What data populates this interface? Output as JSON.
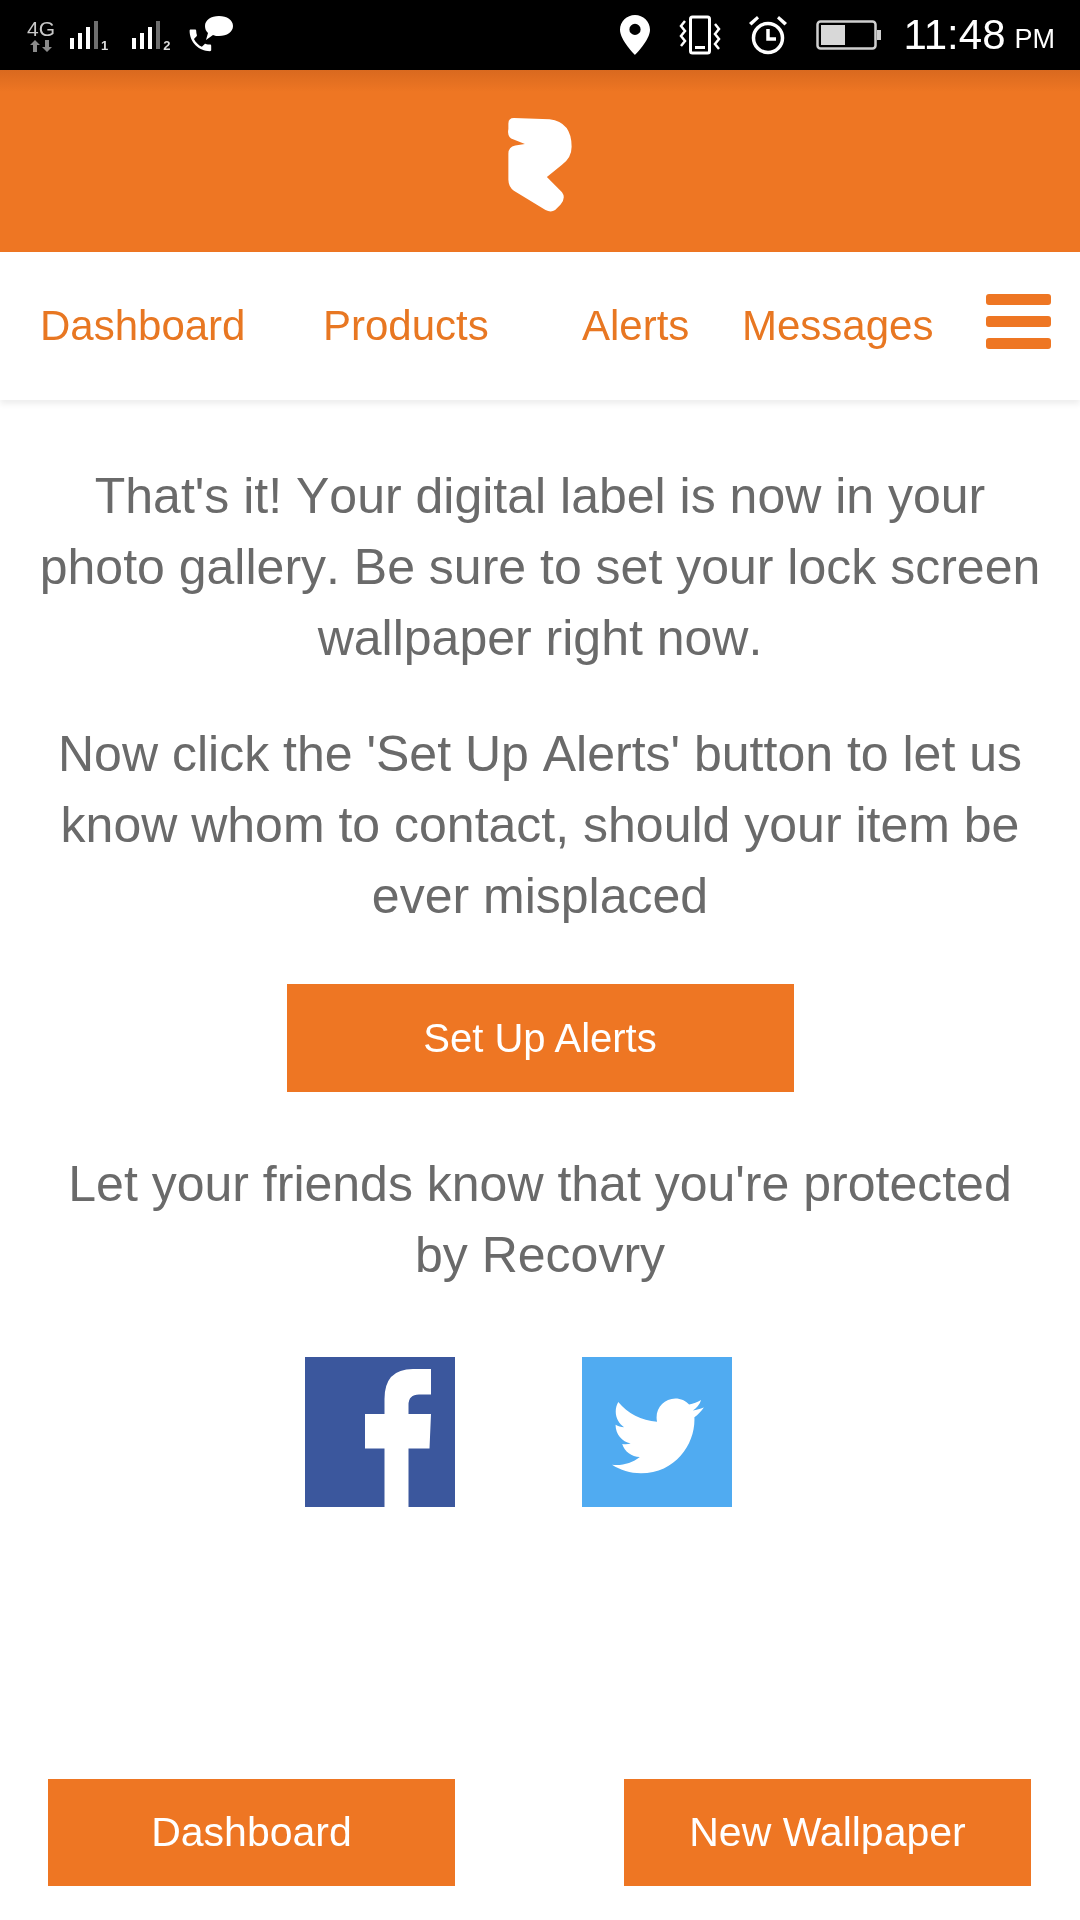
{
  "status_bar": {
    "network": "4G",
    "sim_labels": [
      "1",
      "2"
    ],
    "time": "11:48",
    "meridiem": "PM"
  },
  "nav": {
    "items": [
      {
        "label": "Dashboard"
      },
      {
        "label": "Products"
      },
      {
        "label": "Alerts"
      },
      {
        "label": "Messages"
      }
    ]
  },
  "message": {
    "paragraphs": [
      "That's it! Your digital label is now in your photo gallery. Be sure to set your lock screen wallpaper right now.",
      "Now click the 'Set Up Alerts' button to let us know whom to contact, should your item be ever misplaced"
    ],
    "button": "Set Up Alerts"
  },
  "share": {
    "text": "Let your friends know that you're protected by Recovry",
    "links": [
      {
        "kind": "facebook"
      },
      {
        "kind": "twitter"
      }
    ]
  },
  "footer_buttons": [
    {
      "label": "Dashboard"
    },
    {
      "label": "New Wallpaper"
    }
  ]
}
